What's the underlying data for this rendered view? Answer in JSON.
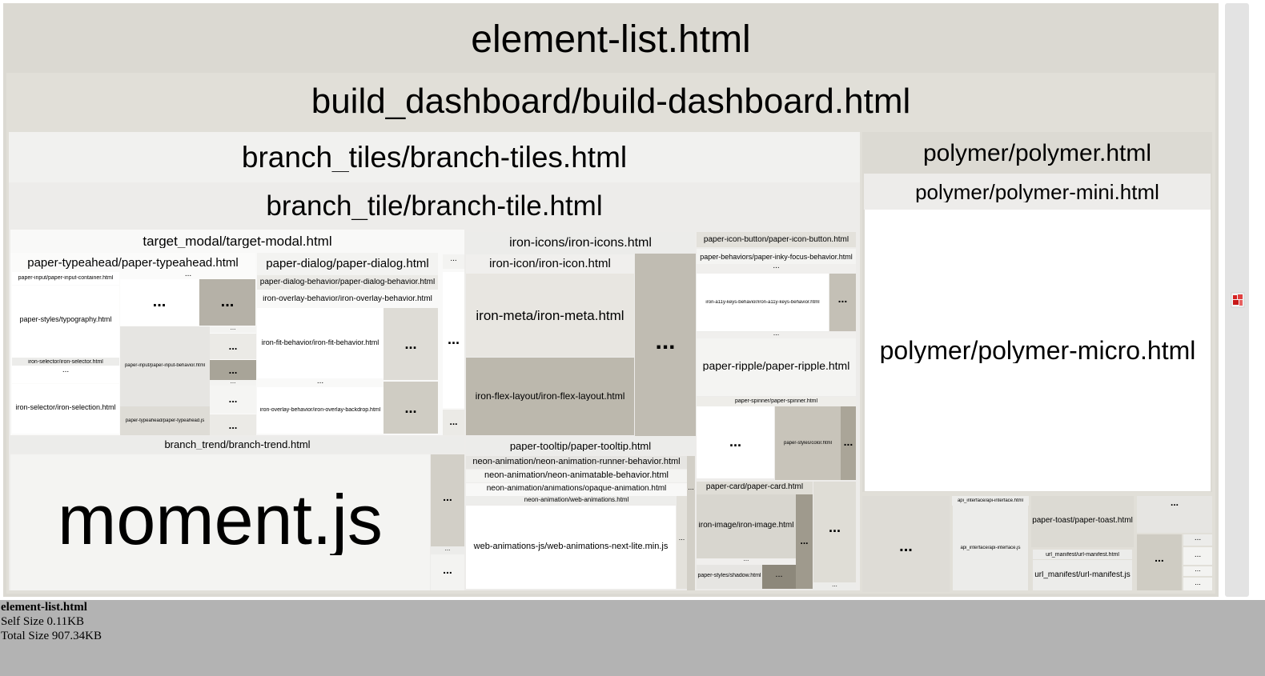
{
  "treemap": {
    "root": "element-list.html",
    "nodes": [
      {
        "id": "element-list",
        "label": "element-list.html"
      },
      {
        "id": "build-dashboard",
        "label": "build_dashboard/build-dashboard.html"
      },
      {
        "id": "branch-tiles",
        "label": "branch_tiles/branch-tiles.html"
      },
      {
        "id": "branch-tile",
        "label": "branch_tile/branch-tile.html"
      },
      {
        "id": "target-modal",
        "label": "target_modal/target-modal.html"
      },
      {
        "id": "paper-typeahead",
        "label": "paper-typeahead/paper-typeahead.html"
      },
      {
        "id": "paper-input-container",
        "label": "paper-input/paper-input-container.html"
      },
      {
        "id": "typography",
        "label": "paper-styles/typography.html"
      },
      {
        "id": "iron-selector",
        "label": "iron-selector/iron-selector.html"
      },
      {
        "id": "iron-selection",
        "label": "iron-selector/iron-selection.html"
      },
      {
        "id": "paper-input-behavior",
        "label": "paper-input/paper-input-behavior.html"
      },
      {
        "id": "paper-typeahead-js",
        "label": "paper-typeahead/paper-typeahead.js"
      },
      {
        "id": "paper-dialog",
        "label": "paper-dialog/paper-dialog.html"
      },
      {
        "id": "paper-dialog-behavior",
        "label": "paper-dialog-behavior/paper-dialog-behavior.html"
      },
      {
        "id": "iron-overlay-behavior",
        "label": "iron-overlay-behavior/iron-overlay-behavior.html"
      },
      {
        "id": "iron-fit-behavior",
        "label": "iron-fit-behavior/iron-fit-behavior.html"
      },
      {
        "id": "iron-overlay-backdrop",
        "label": "iron-overlay-behavior/iron-overlay-backdrop.html"
      },
      {
        "id": "iron-icons",
        "label": "iron-icons/iron-icons.html"
      },
      {
        "id": "iron-icon",
        "label": "iron-icon/iron-icon.html"
      },
      {
        "id": "iron-meta",
        "label": "iron-meta/iron-meta.html"
      },
      {
        "id": "iron-flex-layout",
        "label": "iron-flex-layout/iron-flex-layout.html"
      },
      {
        "id": "paper-icon-button",
        "label": "paper-icon-button/paper-icon-button.html"
      },
      {
        "id": "paper-inky-focus",
        "label": "paper-behaviors/paper-inky-focus-behavior.html"
      },
      {
        "id": "iron-a11y-keys",
        "label": "iron-a11y-keys-behavior/iron-a11y-keys-behavior.html"
      },
      {
        "id": "paper-ripple",
        "label": "paper-ripple/paper-ripple.html"
      },
      {
        "id": "paper-spinner",
        "label": "paper-spinner/paper-spinner.html"
      },
      {
        "id": "color",
        "label": "paper-styles/color.html"
      },
      {
        "id": "branch-trend",
        "label": "branch_trend/branch-trend.html"
      },
      {
        "id": "moment",
        "label": "moment.js"
      },
      {
        "id": "paper-tooltip",
        "label": "paper-tooltip/paper-tooltip.html"
      },
      {
        "id": "neon-runner",
        "label": "neon-animation/neon-animation-runner-behavior.html"
      },
      {
        "id": "neon-animatable",
        "label": "neon-animation/neon-animatable-behavior.html"
      },
      {
        "id": "opaque-animation",
        "label": "neon-animation/animations/opaque-animation.html"
      },
      {
        "id": "web-animations",
        "label": "neon-animation/web-animations.html"
      },
      {
        "id": "web-animations-lite",
        "label": "web-animations-js/web-animations-next-lite.min.js"
      },
      {
        "id": "paper-card",
        "label": "paper-card/paper-card.html"
      },
      {
        "id": "iron-image",
        "label": "iron-image/iron-image.html"
      },
      {
        "id": "shadow",
        "label": "paper-styles/shadow.html"
      },
      {
        "id": "polymer",
        "label": "polymer/polymer.html"
      },
      {
        "id": "polymer-mini",
        "label": "polymer/polymer-mini.html"
      },
      {
        "id": "polymer-micro",
        "label": "polymer/polymer-micro.html"
      },
      {
        "id": "api-interface-html",
        "label": "api_interface/api-interface.html"
      },
      {
        "id": "api-interface-js",
        "label": "api_interface/api-interface.js"
      },
      {
        "id": "paper-toast",
        "label": "paper-toast/paper-toast.html"
      },
      {
        "id": "url-manifest-html",
        "label": "url_manifest/url-manifest.html"
      },
      {
        "id": "url-manifest-js",
        "label": "url_manifest/url-manifest.js"
      },
      {
        "id": "more",
        "label": "..."
      }
    ]
  },
  "info": {
    "name": "element-list.html",
    "self_size": "Self Size 0.11KB",
    "total_size": "Total Size 907.34KB"
  }
}
